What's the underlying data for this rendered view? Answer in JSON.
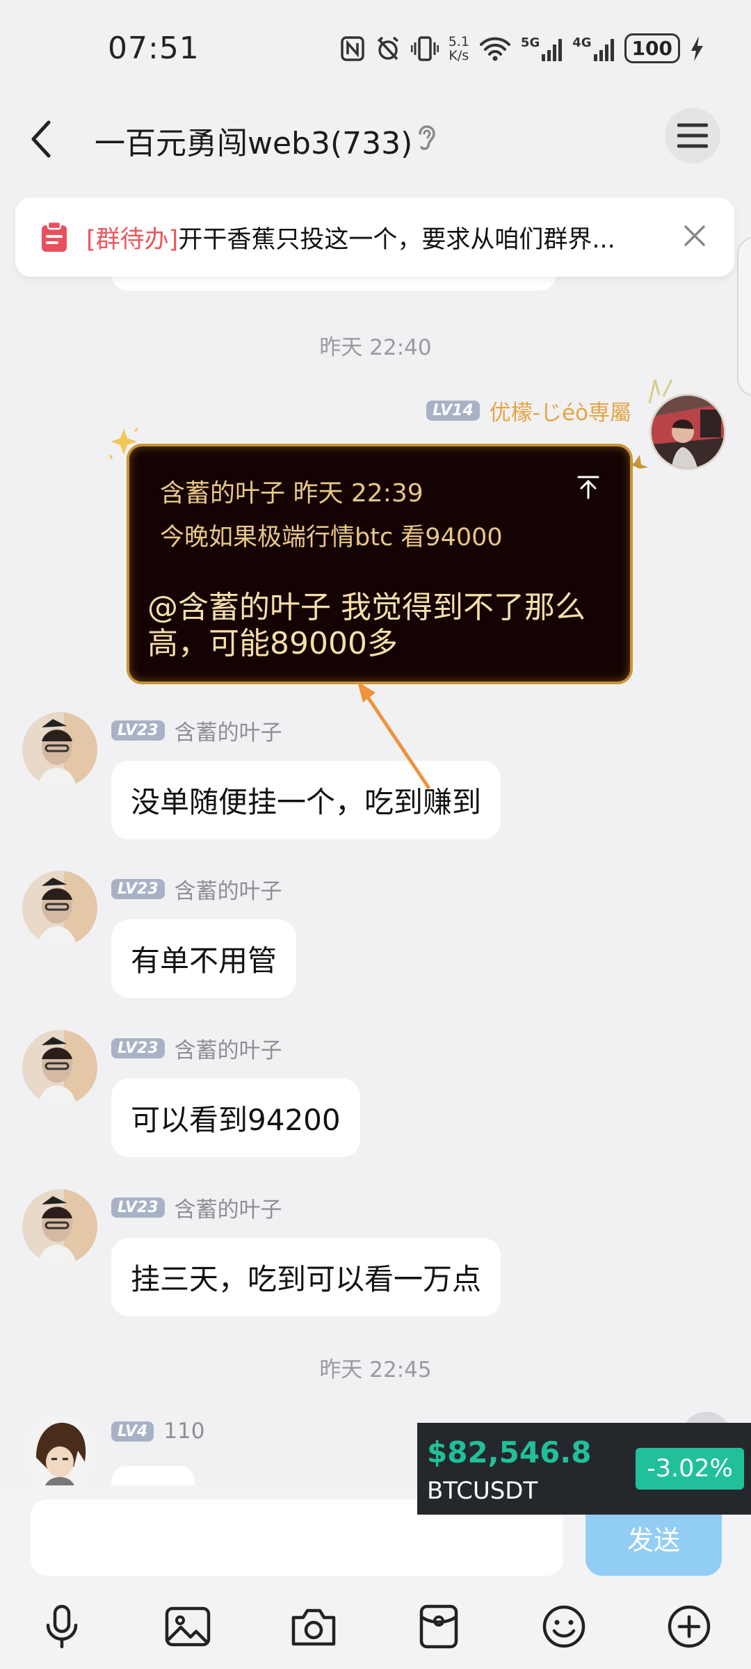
{
  "status_bar": {
    "time": "07:51",
    "net_speed_value": "5.1",
    "net_speed_unit": "K/s",
    "signal_5g": "5G",
    "signal_4g": "4G",
    "battery": "100"
  },
  "header": {
    "title": "一百元勇闯web3(733)"
  },
  "pinned": {
    "tag": "[群待办]",
    "text": "开干香蕉只投这一个，要求从咱们群界..."
  },
  "timestamps": [
    "昨天 22:40",
    "昨天 22:45"
  ],
  "self_message": {
    "level": "LV14",
    "sender": "优檬-じéò専屬",
    "quote_author_time": "含蓄的叶子 昨天 22:39",
    "quote_text": "今晚如果极端行情btc 看94000",
    "reply": "@含蓄的叶子 我觉得到不了那么高，可能89000多"
  },
  "messages": [
    {
      "level": "LV23",
      "sender": "含蓄的叶子",
      "text": "没单随便挂一个，吃到赚到"
    },
    {
      "level": "LV23",
      "sender": "含蓄的叶子",
      "text": "有单不用管"
    },
    {
      "level": "LV23",
      "sender": "含蓄的叶子",
      "text": "可以看到94200"
    },
    {
      "level": "LV23",
      "sender": "含蓄的叶子",
      "text": "挂三天，吃到可以看一万点"
    }
  ],
  "last_message": {
    "level": "LV4",
    "sender": "110"
  },
  "ticker": {
    "price": "$82,546.8",
    "symbol": "BTCUSDT",
    "change": "-3.02%"
  },
  "composer": {
    "placeholder": "",
    "send_label": "发送"
  },
  "colors": {
    "accent_gold": "#c89434",
    "ticker_green": "#21c09a",
    "send_blue": "#92cdf5",
    "pin_red": "#e8585b"
  }
}
